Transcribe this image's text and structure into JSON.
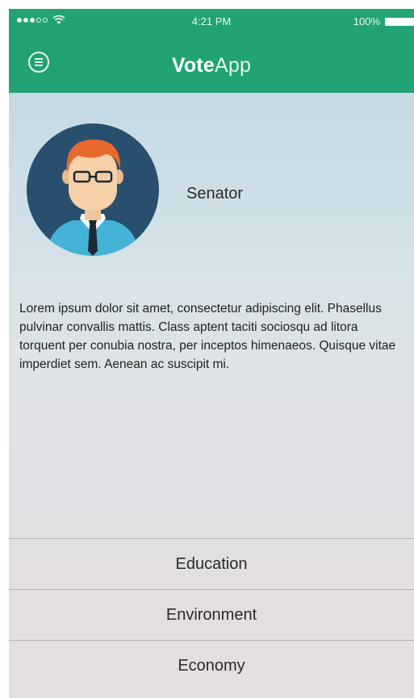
{
  "status_bar": {
    "time": "4:21 PM",
    "battery": "100%"
  },
  "app": {
    "title_bold": "Vote",
    "title_light": "App",
    "brand_color": "#21a373"
  },
  "profile": {
    "role": "Senator",
    "bio": "Lorem ipsum dolor sit amet, consectetur adipiscing elit. Phasellus pulvinar convallis mattis. Class aptent taciti sociosqu ad litora torquent per conubia nostra, per inceptos himenaeos. Quisque vitae imperdiet sem. Aenean ac suscipit mi."
  },
  "topics": [
    {
      "label": "Education"
    },
    {
      "label": "Environment"
    },
    {
      "label": "Economy"
    }
  ]
}
